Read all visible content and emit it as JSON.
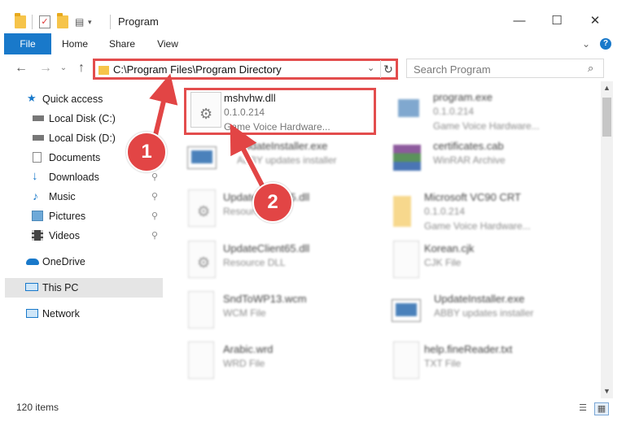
{
  "window": {
    "title": "Program",
    "minimize": "—",
    "maximize": "☐",
    "close": "✕"
  },
  "ribbon": {
    "tabs": [
      {
        "label": "File"
      },
      {
        "label": "Home"
      },
      {
        "label": "Share"
      },
      {
        "label": "View"
      }
    ],
    "expand": "⌄",
    "help": "?"
  },
  "nav": {
    "back": "←",
    "forward": "→",
    "recent": "⌄",
    "up": "↑"
  },
  "address": {
    "path": "C:\\Program Files\\Program Directory",
    "dropdown": "⌄",
    "refresh": "↻"
  },
  "search": {
    "placeholder": "Search Program",
    "icon": "⌕"
  },
  "sidebar": {
    "items": [
      {
        "label": "Quick access",
        "icon": "star-icon"
      },
      {
        "label": "Local Disk (C:)",
        "icon": "drive-icon"
      },
      {
        "label": "Local Disk (D:)",
        "icon": "drive-icon"
      },
      {
        "label": "Documents",
        "icon": "documents-icon"
      },
      {
        "label": "Downloads",
        "icon": "download-icon",
        "pinned": true
      },
      {
        "label": "Music",
        "icon": "music-icon",
        "pinned": true
      },
      {
        "label": "Pictures",
        "icon": "pictures-icon",
        "pinned": true
      },
      {
        "label": "Videos",
        "icon": "videos-icon",
        "pinned": true
      },
      {
        "label": "OneDrive",
        "icon": "cloud-icon"
      },
      {
        "label": "This PC",
        "icon": "computer-icon",
        "selected": true
      },
      {
        "label": "Network",
        "icon": "network-icon"
      }
    ],
    "pin_glyph": "📌"
  },
  "files": [
    {
      "name": "mshvhw.dll",
      "line1": "0.1.0.214",
      "line2": "Game Voice Hardware..."
    },
    {
      "name": "program.exe",
      "line1": "0.1.0.214",
      "line2": "Game Voice Hardware..."
    },
    {
      "name": "UpdateInstaller.exe",
      "line1": "ABBY updates installer",
      "line2": ""
    },
    {
      "name": "certificates.cab",
      "line1": "WinRAR Archive",
      "line2": ""
    },
    {
      "name": "UpdateClient65.dll",
      "line1": "Resource DLL",
      "line2": ""
    },
    {
      "name": "Microsoft VC90 CRT",
      "line1": "0.1.0.214",
      "line2": "Game Voice Hardware..."
    },
    {
      "name": "UpdateClient65.dll",
      "line1": "Resource DLL",
      "line2": ""
    },
    {
      "name": "Korean.cjk",
      "line1": "CJK File",
      "line2": ""
    },
    {
      "name": "SndToWP13.wcm",
      "line1": "WCM File",
      "line2": ""
    },
    {
      "name": "UpdateInstaller.exe",
      "line1": "ABBY updates installer",
      "line2": ""
    },
    {
      "name": "Arabic.wrd",
      "line1": "WRD File",
      "line2": ""
    },
    {
      "name": "help.fineReader.txt",
      "line1": "TXT File",
      "line2": ""
    }
  ],
  "status": {
    "count": "120 items"
  },
  "callouts": {
    "one": "1",
    "two": "2"
  },
  "colors": {
    "accent": "#1979ca",
    "highlight": "#e34d4d",
    "folder": "#f6c44a"
  }
}
